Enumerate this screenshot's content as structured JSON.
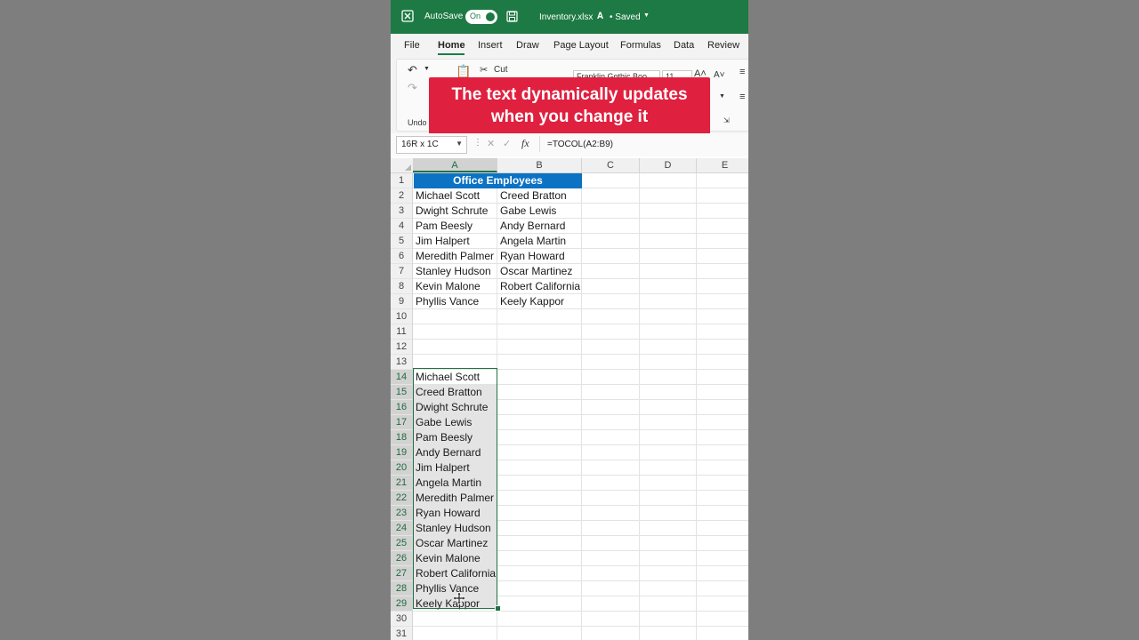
{
  "titlebar": {
    "autosave_label": "AutoSave",
    "autosave_state": "On",
    "filename": "Inventory.xlsx",
    "saved_status": "• Saved",
    "accent_color": "#1e7a44"
  },
  "menu": {
    "items": [
      "File",
      "Home",
      "Insert",
      "Draw",
      "Page Layout",
      "Formulas",
      "Data",
      "Review"
    ],
    "active": "Home"
  },
  "ribbon": {
    "cut_label": "Cut",
    "undo_label": "Undo",
    "font_name": "Franklin Gothic Boo",
    "font_size": "11"
  },
  "overlay": {
    "caption": "The text dynamically updates when you change it",
    "color": "#e0203f"
  },
  "formula_bar": {
    "name_box": "16R x 1C",
    "fx_label": "fx",
    "formula": "=TOCOL(A2:B9)"
  },
  "sheet": {
    "columns": [
      "A",
      "B",
      "C",
      "D",
      "E"
    ],
    "rows": [
      "1",
      "2",
      "3",
      "4",
      "5",
      "6",
      "7",
      "8",
      "9",
      "10",
      "11",
      "12",
      "13",
      "14",
      "15",
      "16",
      "17",
      "18",
      "19",
      "20",
      "21",
      "22",
      "23",
      "24",
      "25",
      "26",
      "27",
      "28",
      "29",
      "30",
      "31"
    ],
    "header_title": "Office Employees",
    "header_color": "#0b72c4",
    "col_a": [
      "Michael Scott",
      "Dwight Schrute",
      "Pam Beesly",
      "Jim Halpert",
      "Meredith Palmer",
      "Stanley Hudson",
      "Kevin Malone",
      "Phyllis Vance"
    ],
    "col_b": [
      "Creed Bratton",
      "Gabe Lewis",
      "Andy Bernard",
      "Angela Martin",
      "Ryan Howard",
      "Oscar Martinez",
      "Robert California",
      "Keely Kappor"
    ],
    "tocol_results": [
      "Michael Scott",
      "Creed Bratton",
      "Dwight Schrute",
      "Gabe Lewis",
      "Pam Beesly",
      "Andy Bernard",
      "Jim Halpert",
      "Angela Martin",
      "Meredith Palmer",
      "Ryan Howard",
      "Stanley Hudson",
      "Oscar Martinez",
      "Kevin Malone",
      "Robert California",
      "Phyllis Vance",
      "Keely Kappor"
    ],
    "selection_color": "#217346"
  }
}
